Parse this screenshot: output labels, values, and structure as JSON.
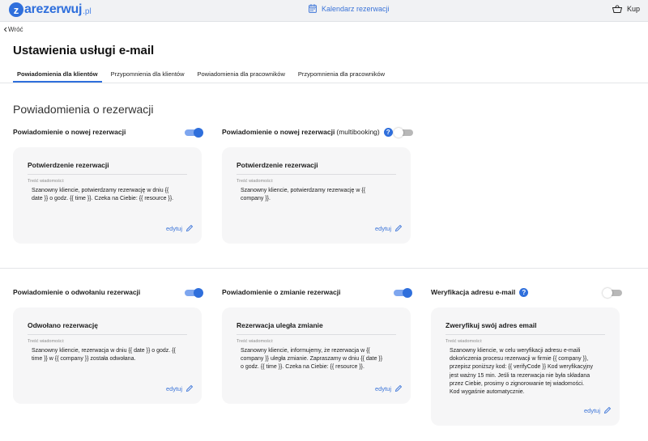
{
  "header": {
    "logo_letter": "z",
    "logo_name": "arezerwuj",
    "logo_tld": ".pl",
    "calendar_label": "Kalendarz rezerwacji",
    "buy_label": "Kup"
  },
  "back_label": "Wróć",
  "page_title": "Ustawienia usługi e-mail",
  "tabs": [
    {
      "label": "Powiadomienia dla klientów",
      "active": true
    },
    {
      "label": "Przypomnienia dla klientów",
      "active": false
    },
    {
      "label": "Powiadomienia dla pracowników",
      "active": false
    },
    {
      "label": "Przypomnienia dla pracowników",
      "active": false
    }
  ],
  "section_title": "Powiadomienia o rezerwacji",
  "notifications": [
    {
      "heading": "Powiadomienie o nowej rezerwacji",
      "enabled": true,
      "card_title": "Potwierdzenie rezerwacji",
      "content_label": "Treść wiadomości:",
      "body_lines": [
        "Szanowny kliencie, potwierdzamy rezerwację w dniu {{",
        "date }} o godz. {{ time }}. Czeka na Ciebie: {{ resource }}."
      ],
      "edit_label": "edytuj"
    },
    {
      "heading": "Powiadomienie o nowej rezerwacji",
      "heading_suffix": "(multibooking)",
      "enabled": false,
      "card_title": "Potwierdzenie rezerwacji",
      "content_label": "Treść wiadomości:",
      "body_lines": [
        "Szanowny kliencie, potwierdzamy rezerwację w {{",
        "company }}."
      ],
      "edit_label": "edytuj"
    },
    {
      "heading": "Powiadomienie o odwołaniu rezerwacji",
      "enabled": true,
      "card_title": "Odwołano rezerwację",
      "content_label": "Treść wiadomości:",
      "body_lines": [
        "Szanowny kliencie, rezerwacja w dniu {{ date }} o godz. {{",
        "time }} w {{ company }} została odwołana."
      ],
      "edit_label": "edytuj"
    },
    {
      "heading": "Powiadomienie o zmianie rezerwacji",
      "enabled": true,
      "card_title": "Rezerwacja uległa zmianie",
      "content_label": "Treść wiadomości:",
      "body_lines": [
        "Szanowny kliencie, informujemy, że rezerwacja w {{",
        "company }} uległa zmianie. Zapraszamy w dniu {{ date }}",
        "o godz. {{ time }}. Czeka na Ciebie: {{ resource }}."
      ],
      "edit_label": "edytuj"
    },
    {
      "heading": "Weryfikacja adresu e-mail",
      "enabled": false,
      "card_title": "Zweryfikuj swój adres email",
      "content_label": "Treść wiadomości:",
      "body_lines": [
        "Szanowny kliencie, w celu weryfikacji adresu e-maili",
        "dokończenia procesu rezerwacji w firmie {{ company }},",
        "przepisz poniższy kod: {{ verifyCode }} Kod weryfikacyjny",
        "jest ważny 15 min. Jeśli ta rezerwacja nie była składana",
        "przez Ciebie, prosimy o zignorowanie tej wiadomości.",
        "Kod wygaśnie automatycznie."
      ],
      "edit_label": "edytuj"
    }
  ],
  "colors": {
    "accent": "#2f6fdc",
    "card_bg": "#f6f6f7",
    "toggle_on_track": "#7ea6ef"
  }
}
